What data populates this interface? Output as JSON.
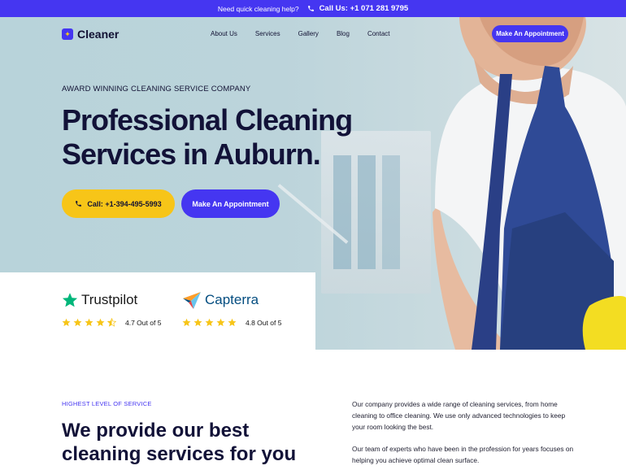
{
  "topbar": {
    "question": "Need quick cleaning help?",
    "call": "Call Us: +1 071 281 9795"
  },
  "brand": {
    "name": "Cleaner"
  },
  "nav": {
    "items": [
      "About Us",
      "Services",
      "Gallery",
      "Blog",
      "Contact"
    ],
    "cta": "Make An Appointment"
  },
  "hero": {
    "eyebrow": "AWARD WINNING CLEANING SERVICE COMPANY",
    "title_part1": "Professional ",
    "title_highlight": "Cleaning",
    "title_line2": "Services in Auburn.",
    "call_button": "Call: +1-394-495-5993",
    "appointment_button": "Make An Appointment"
  },
  "reviews": [
    {
      "brand": "Trustpilot",
      "rating": 4.5,
      "score_text": "4.7 Out of 5",
      "star_color": "#f7c518"
    },
    {
      "brand": "Capterra",
      "rating": 5,
      "score_text": "4.8 Out of 5",
      "star_color": "#f7c518"
    }
  ],
  "section": {
    "eyebrow": "HIGHEST LEVEL OF SERVICE",
    "title_line1": "We provide our best",
    "title_highlight": "cleaning",
    "title_rest": " services for you",
    "paragraph1": "Our company provides a wide range of cleaning services, from home cleaning to office cleaning. We use only advanced technologies to keep your room looking the best.",
    "paragraph2": "Our team of experts who have been in the profession for years focuses on helping you achieve optimal clean surface."
  },
  "colors": {
    "accent": "#4536f1",
    "yellow": "#f7c518",
    "highlight": "#6df03f",
    "trustpilot_green": "#00b67a"
  }
}
